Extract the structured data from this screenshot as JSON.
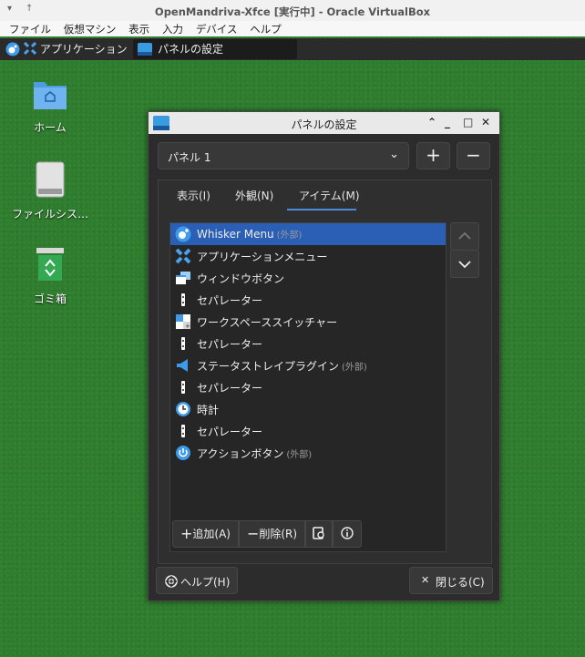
{
  "vbox": {
    "title": "OpenMandriva-Xfce [実行中] - Oracle VirtualBox",
    "menu": [
      "ファイル",
      "仮想マシン",
      "表示",
      "入力",
      "デバイス",
      "ヘルプ"
    ]
  },
  "guest_panel": {
    "apps_label": "アプリケーション",
    "task_label": "パネルの設定"
  },
  "desktop_icons": [
    {
      "label": "ホーム"
    },
    {
      "label": "ファイルシス…"
    },
    {
      "label": "ゴミ箱"
    }
  ],
  "dialog": {
    "title": "パネルの設定",
    "panel_select": "パネル 1",
    "add_symbol": "+",
    "remove_symbol": "−",
    "tabs": [
      "表示(I)",
      "外観(N)",
      "アイテム(M)"
    ],
    "active_tab": "アイテム(M)",
    "items": [
      {
        "name": "Whisker Menu",
        "tag": "(外部)",
        "icon": "whisker-menu-icon"
      },
      {
        "name": "アプリケーションメニュー",
        "tag": "",
        "icon": "xfce-logo-icon"
      },
      {
        "name": "ウィンドウボタン",
        "tag": "",
        "icon": "windows-icon"
      },
      {
        "name": "セパレーター",
        "tag": "",
        "icon": "separator-icon"
      },
      {
        "name": "ワークスペーススイッチャー",
        "tag": "",
        "icon": "workspace-switcher-icon"
      },
      {
        "name": "セパレーター",
        "tag": "",
        "icon": "separator-icon"
      },
      {
        "name": "ステータストレイプラグイン",
        "tag": "(外部)",
        "icon": "status-tray-icon"
      },
      {
        "name": "セパレーター",
        "tag": "",
        "icon": "separator-icon"
      },
      {
        "name": "時計",
        "tag": "",
        "icon": "clock-icon"
      },
      {
        "name": "セパレーター",
        "tag": "",
        "icon": "separator-icon"
      },
      {
        "name": "アクションボタン",
        "tag": "(外部)",
        "icon": "power-icon"
      }
    ],
    "add_label": "追加(A)",
    "remove_label": "削除(R)",
    "help_label": "ヘルプ(H)",
    "close_label": "閉じる(C)"
  }
}
